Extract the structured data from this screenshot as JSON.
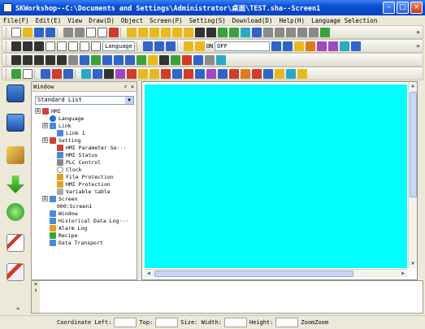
{
  "window": {
    "title": "SKWorkshop--C:\\Documents and Settings\\Administrator\\桌面\\TEST.sha--Screen1",
    "controls": [
      "–",
      "□",
      "×"
    ]
  },
  "menu": [
    "File(F)",
    "Edit(E)",
    "View",
    "Draw(D)",
    "Object",
    "Screen(P)",
    "Setting(S)",
    "Download(D)",
    "Help(H)",
    "Language Selection"
  ],
  "toolbar1": {
    "language_select": "Language"
  },
  "toolbar2": {
    "state_label": "ON",
    "state_select": "OFF"
  },
  "window_panel": {
    "title": "Window",
    "controls": "♯ ×",
    "list_select": "Standard List",
    "tree": [
      {
        "label": "HMI",
        "expander": "⊟",
        "color": "#c44"
      },
      {
        "label": "Language",
        "color": "#2a6ad6"
      },
      {
        "label": "Link",
        "expander": "⊟",
        "color": "#4a8ad8"
      },
      {
        "label": "Link 1",
        "color": "#4a8ad8"
      },
      {
        "label": "Setting",
        "expander": "⊟",
        "color": "#c43"
      },
      {
        "label": "HMI Parameter Se···",
        "color": "#c43"
      },
      {
        "label": "HMI Status",
        "color": "#4a8ad8"
      },
      {
        "label": "PLC Control",
        "color": "#888"
      },
      {
        "label": "Clock",
        "color": "#aaa"
      },
      {
        "label": "File Protection",
        "color": "#e0a020"
      },
      {
        "label": "HMI Protection",
        "color": "#e0a020"
      },
      {
        "label": "Variable table",
        "color": "#aaa"
      },
      {
        "label": "Screen",
        "expander": "⊟",
        "color": "#4a8ad8"
      },
      {
        "label": "000:Screen1",
        "color": "#aaa"
      },
      {
        "label": "Window",
        "color": "#4a8ad8"
      },
      {
        "label": "Historical Data Log···",
        "color": "#4a8ad8"
      },
      {
        "label": "Alarm Log",
        "color": "#e0a020"
      },
      {
        "label": "Recipe",
        "color": "#3aa23a"
      },
      {
        "label": "Data Transport",
        "color": "#4a8ad8"
      }
    ]
  },
  "output_panel": {
    "controls": "× ♯",
    "collapse": "»"
  },
  "statusbar": {
    "coord_label": "Coordinate Left:",
    "top_label": "Top:",
    "size_label": "Size: Width:",
    "height_label": "Height:",
    "zoom_label": "ZoomZoom"
  },
  "colors": {
    "canvas": "#00ffff",
    "titlebar": "#0a4fd4",
    "chrome": "#ece9d8"
  }
}
